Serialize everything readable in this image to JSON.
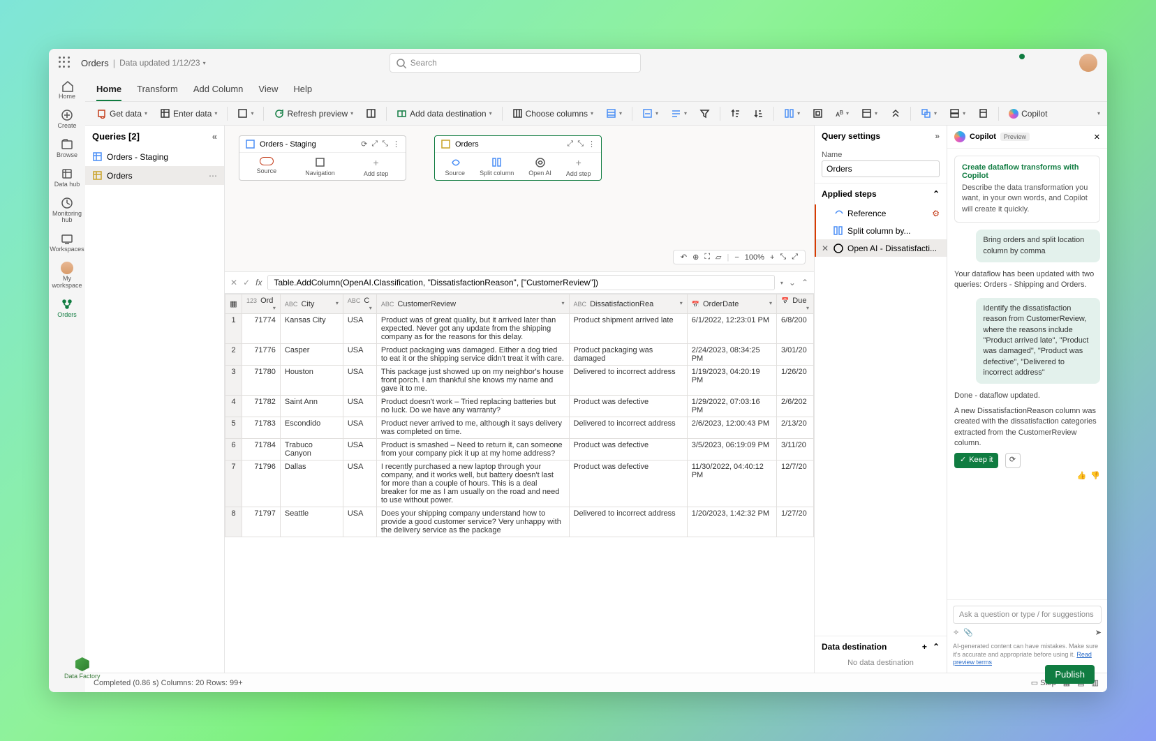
{
  "topbar": {
    "title": "Orders",
    "subtitle": "Data updated 1/12/23",
    "search_placeholder": "Search"
  },
  "leftrail": [
    {
      "id": "home",
      "label": "Home"
    },
    {
      "id": "create",
      "label": "Create"
    },
    {
      "id": "browse",
      "label": "Browse"
    },
    {
      "id": "datahub",
      "label": "Data hub"
    },
    {
      "id": "monitor",
      "label": "Monitoring hub"
    },
    {
      "id": "workspaces",
      "label": "Workspaces"
    },
    {
      "id": "myws",
      "label": "My workspace"
    },
    {
      "id": "orders",
      "label": "Orders",
      "active": true
    }
  ],
  "tabs": [
    "Home",
    "Transform",
    "Add Column",
    "View",
    "Help"
  ],
  "ribbon": {
    "getdata": "Get data",
    "enterdata": "Enter data",
    "refresh": "Refresh preview",
    "adddest": "Add data destination",
    "choosecols": "Choose columns",
    "copilot": "Copilot"
  },
  "queries": {
    "header": "Queries [2]",
    "items": [
      "Orders - Staging",
      "Orders"
    ]
  },
  "nodes": {
    "a": {
      "title": "Orders - Staging",
      "steps": [
        "Source",
        "Navigation",
        "Add step"
      ]
    },
    "b": {
      "title": "Orders",
      "steps": [
        "Source",
        "Split column",
        "Open AI",
        "Add step"
      ]
    }
  },
  "zoom": "100%",
  "fx": "Table.AddColumn(OpenAI.Classification, \"DissatisfactionReason\", [\"CustomerReview\"])",
  "cols": [
    "",
    "Ord",
    "City",
    "C",
    "CustomerReview",
    "DissatisfactionRea",
    "OrderDate",
    "Due"
  ],
  "coltypes": [
    "",
    "123",
    "ABC",
    "ABC",
    "ABC",
    "ABC",
    "📅",
    "📅"
  ],
  "rows": [
    {
      "n": 1,
      "ord": "71774",
      "city": "Kansas City",
      "c": "USA",
      "rev": "Product was of great quality, but it arrived later than expected. Never got any update from the shipping company as for the reasons for this delay.",
      "dis": "Product shipment arrived late",
      "date": "6/1/2022, 12:23:01 PM",
      "due": "6/8/200"
    },
    {
      "n": 2,
      "ord": "71776",
      "city": "Casper",
      "c": "USA",
      "rev": "Product packaging was damaged. Either a dog tried to eat it or the shipping service didn't treat it with care.",
      "dis": "Product packaging was damaged",
      "date": "2/24/2023, 08:34:25 PM",
      "due": "3/01/20"
    },
    {
      "n": 3,
      "ord": "71780",
      "city": "Houston",
      "c": "USA",
      "rev": "This package just showed up on my neighbor's house front porch. I am thankful she knows my name and gave it to me.",
      "dis": "Delivered to incorrect address",
      "date": "1/19/2023, 04:20:19 PM",
      "due": "1/26/20"
    },
    {
      "n": 4,
      "ord": "71782",
      "city": "Saint Ann",
      "c": "USA",
      "rev": "Product doesn't work – Tried replacing batteries but no luck. Do we have any warranty?",
      "dis": "Product was defective",
      "date": "1/29/2022, 07:03:16 PM",
      "due": "2/6/202"
    },
    {
      "n": 5,
      "ord": "71783",
      "city": "Escondido",
      "c": "USA",
      "rev": "Product never arrived to me, although it says delivery was completed on time.",
      "dis": "Delivered to incorrect address",
      "date": "2/6/2023, 12:00:43 PM",
      "due": "2/13/20"
    },
    {
      "n": 6,
      "ord": "71784",
      "city": "Trabuco Canyon",
      "c": "USA",
      "rev": "Product is smashed – Need to return it, can someone from your company pick it up at my home address?",
      "dis": "Product was defective",
      "date": "3/5/2023, 06:19:09 PM",
      "due": "3/11/20"
    },
    {
      "n": 7,
      "ord": "71796",
      "city": "Dallas",
      "c": "USA",
      "rev": "I recently purchased a new laptop through your company, and it works well, but battery doesn't last for more than a couple of hours. This is a deal breaker for me as I am usually on the road and need to use without power.",
      "dis": "Product was defective",
      "date": "11/30/2022, 04:40:12 PM",
      "due": "12/7/20"
    },
    {
      "n": 8,
      "ord": "71797",
      "city": "Seattle",
      "c": "USA",
      "rev": "Does your shipping company understand how to provide a good customer service? Very unhappy with the delivery service as the package",
      "dis": "Delivered to incorrect address",
      "date": "1/20/2023, 1:42:32 PM",
      "due": "1/27/20"
    }
  ],
  "settings": {
    "title": "Query settings",
    "namelbl": "Name",
    "name": "Orders",
    "steps_title": "Applied steps",
    "steps": [
      {
        "label": "Reference",
        "icon": "ref"
      },
      {
        "label": "Split column by...",
        "icon": "split"
      },
      {
        "label": "Open AI - Dissatisfacti...",
        "icon": "ai",
        "sel": true
      }
    ],
    "dest_title": "Data destination",
    "dest_none": "No data destination"
  },
  "copilot": {
    "title": "Copilot",
    "preview": "Preview",
    "card_title": "Create dataflow transforms with Copilot",
    "card_desc": "Describe the data transformation you want, in your own words, and Copilot will create it quickly.",
    "msg1": "Bring orders and split location column by comma",
    "msg2": "Your dataflow has been updated with two queries:  Orders - Shipping and Orders.",
    "msg3": "Identify the dissatisfaction reason from CustomerReview, where the reasons include \"Product arrived late\", \"Product was damaged\", \"Product was defective\", \"Delivered to incorrect address\"",
    "msg4a": "Done - dataflow updated.",
    "msg4b": "A new DissatisfactionReason column was created with the dissatisfaction categories extracted from the CustomerReview column.",
    "keep": "Keep it",
    "placeholder": "Ask a question or type / for suggestions",
    "disclaimer": "AI-generated content can have mistakes. Make sure it's accurate and appropriate before using it.",
    "terms": "Read preview terms"
  },
  "status": {
    "text": "Completed (0.86 s)  Columns: 20  Rows: 99+",
    "step": "Step"
  },
  "publish": "Publish",
  "datafactory": "Data Factory"
}
